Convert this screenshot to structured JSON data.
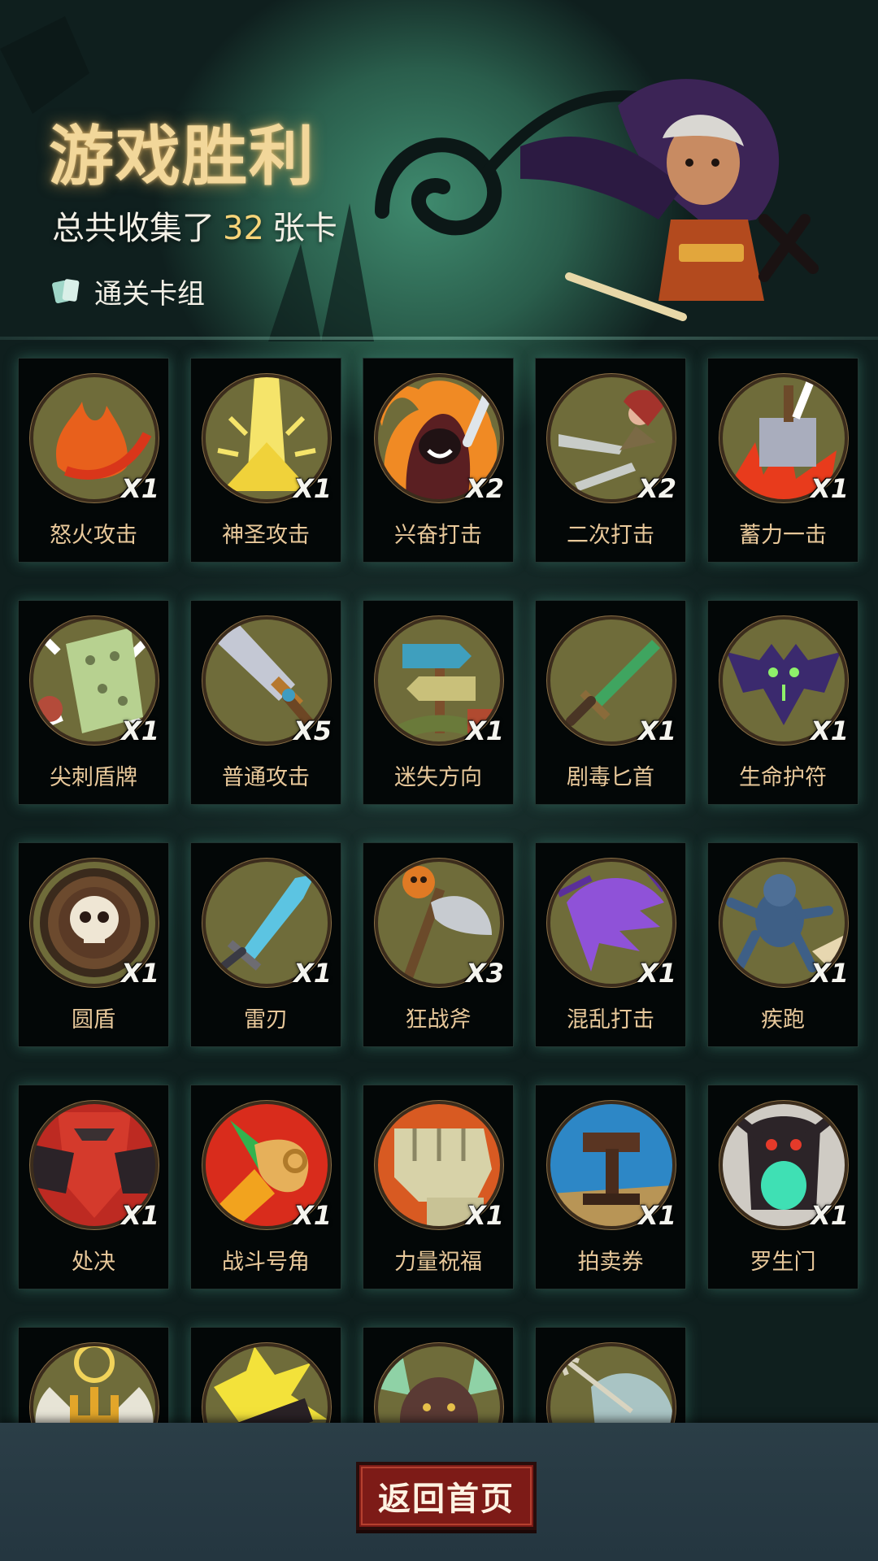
{
  "header": {
    "title": "游戏胜利",
    "summary_prefix": "总共收集了",
    "card_total": "32",
    "summary_suffix": "张卡",
    "deck_label": "通关卡组"
  },
  "cards": [
    {
      "name": "怒火攻击",
      "count": "X1",
      "icon": "fire-slash-icon"
    },
    {
      "name": "神圣攻击",
      "count": "X1",
      "icon": "holy-light-icon"
    },
    {
      "name": "兴奋打击",
      "count": "X2",
      "icon": "hooded-warrior-icon"
    },
    {
      "name": "二次打击",
      "count": "X2",
      "icon": "twin-daggers-icon"
    },
    {
      "name": "蓄力一击",
      "count": "X1",
      "icon": "hammer-smash-icon"
    },
    {
      "name": "尖刺盾牌",
      "count": "X1",
      "icon": "spiked-shield-icon"
    },
    {
      "name": "普通攻击",
      "count": "X5",
      "icon": "sword-icon"
    },
    {
      "name": "迷失方向",
      "count": "X1",
      "icon": "signpost-icon"
    },
    {
      "name": "剧毒匕首",
      "count": "X1",
      "icon": "poison-dagger-icon"
    },
    {
      "name": "生命护符",
      "count": "X1",
      "icon": "bat-amulet-icon"
    },
    {
      "name": "圆盾",
      "count": "X1",
      "icon": "skull-round-shield-icon"
    },
    {
      "name": "雷刃",
      "count": "X1",
      "icon": "crystal-blade-icon"
    },
    {
      "name": "狂战斧",
      "count": "X3",
      "icon": "pumpkin-axe-icon"
    },
    {
      "name": "混乱打击",
      "count": "X1",
      "icon": "purple-claw-icon"
    },
    {
      "name": "疾跑",
      "count": "X1",
      "icon": "running-wolf-icon"
    },
    {
      "name": "处决",
      "count": "X1",
      "icon": "execution-icon"
    },
    {
      "name": "战斗号角",
      "count": "X1",
      "icon": "war-horn-icon"
    },
    {
      "name": "力量祝福",
      "count": "X1",
      "icon": "fist-icon"
    },
    {
      "name": "拍卖券",
      "count": "X1",
      "icon": "gavel-icon"
    },
    {
      "name": "罗生门",
      "count": "X1",
      "icon": "demon-gate-icon"
    },
    {
      "name": "",
      "count": "",
      "icon": "winged-trident-icon"
    },
    {
      "name": "",
      "count": "",
      "icon": "burst-club-icon"
    },
    {
      "name": "",
      "count": "",
      "icon": "boar-icon"
    },
    {
      "name": "",
      "count": "",
      "icon": "arrow-stone-icon"
    }
  ],
  "footer": {
    "home_button_label": "返回首页"
  },
  "colors": {
    "title_gold": "#f2d79a",
    "count_gold": "#f7d479",
    "card_name": "#e8c89a",
    "icon_bg": "#6f6c3a",
    "icon_ring": "#8a6f45",
    "button_red": "#7d1b17",
    "footer_bg": "#2b3e47"
  }
}
